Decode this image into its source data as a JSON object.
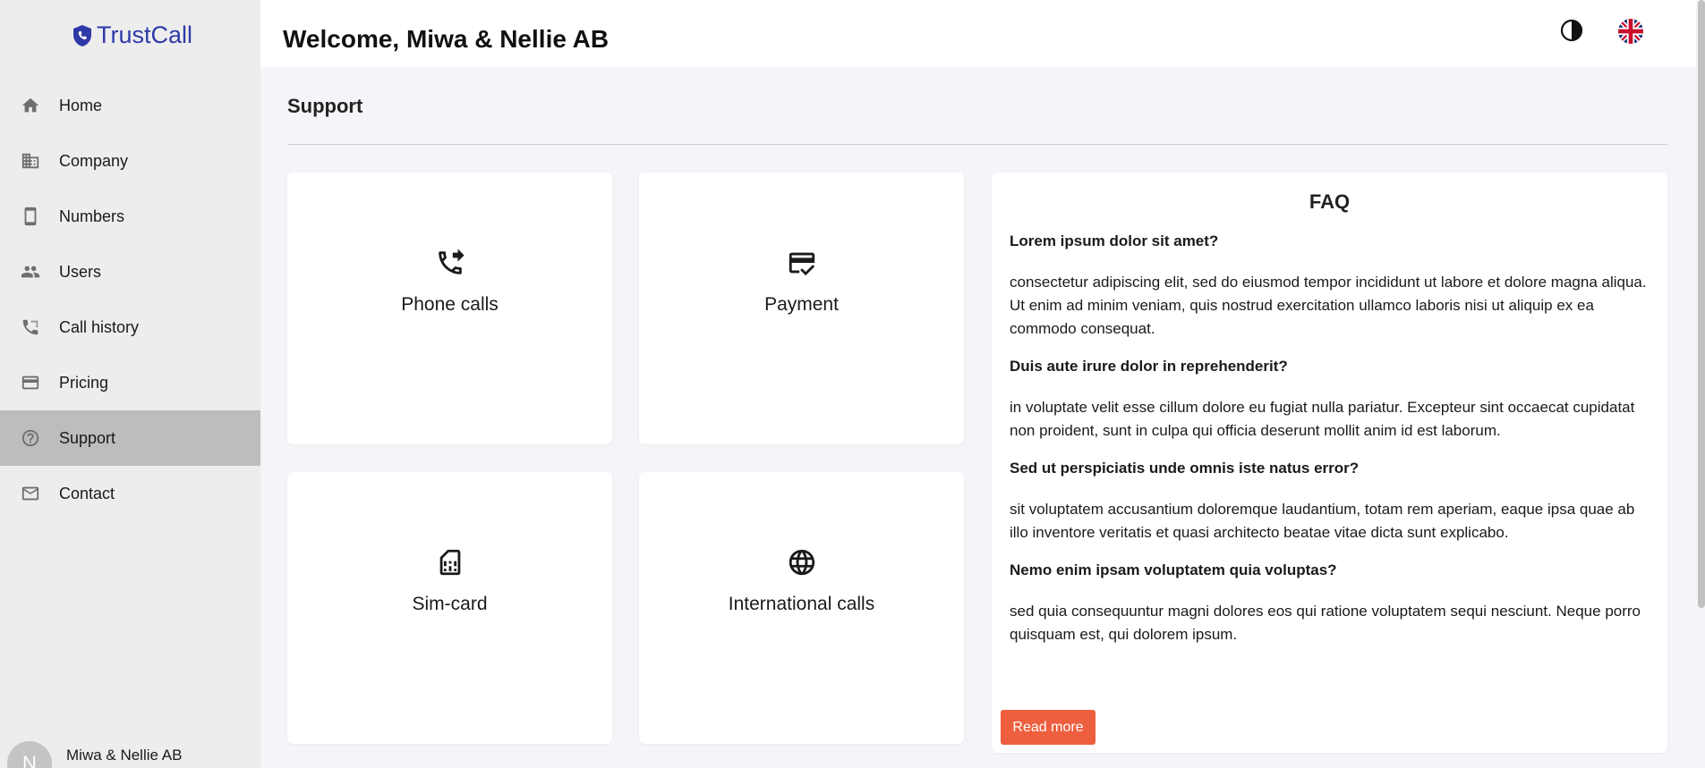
{
  "app": {
    "logo_text": "TrustCall",
    "logo_color": "#2f3aa8"
  },
  "sidebar": {
    "items": [
      {
        "label": "Home",
        "icon": "home-icon"
      },
      {
        "label": "Company",
        "icon": "building-icon"
      },
      {
        "label": "Numbers",
        "icon": "smartphone-icon"
      },
      {
        "label": "Users",
        "icon": "users-icon"
      },
      {
        "label": "Call history",
        "icon": "call-history-icon"
      },
      {
        "label": "Pricing",
        "icon": "credit-card-icon"
      },
      {
        "label": "Support",
        "icon": "help-circle-icon",
        "active": true
      },
      {
        "label": "Contact",
        "icon": "mail-icon"
      }
    ],
    "user": {
      "avatar_initial": "N",
      "name": "Miwa & Nellie AB"
    }
  },
  "header": {
    "title": "Welcome, Miwa & Nellie AB",
    "theme_icon": "contrast-icon",
    "language_icon": "uk-flag-icon"
  },
  "main": {
    "section_title": "Support",
    "cards": [
      {
        "label": "Phone calls",
        "icon": "phone-forwarded-icon"
      },
      {
        "label": "Payment",
        "icon": "payment-card-check-icon"
      },
      {
        "label": "Sim-card",
        "icon": "sim-card-icon"
      },
      {
        "label": "International calls",
        "icon": "globe-icon"
      }
    ],
    "faq": {
      "title": "FAQ",
      "items": [
        {
          "q": "Lorem ipsum dolor sit amet?",
          "a": "consectetur adipiscing elit, sed do eiusmod tempor incididunt ut labore et dolore magna aliqua. Ut enim ad minim veniam, quis nostrud exercitation ullamco laboris nisi ut aliquip ex ea commodo consequat."
        },
        {
          "q": "Duis aute irure dolor in reprehenderit?",
          "a": "in voluptate velit esse cillum dolore eu fugiat nulla pariatur. Excepteur sint occaecat cupidatat non proident, sunt in culpa qui officia deserunt mollit anim id est laborum."
        },
        {
          "q": "Sed ut perspiciatis unde omnis iste natus error?",
          "a": "sit voluptatem accusantium doloremque laudantium, totam rem aperiam, eaque ipsa quae ab illo inventore veritatis et quasi architecto beatae vitae dicta sunt explicabo."
        },
        {
          "q": "Nemo enim ipsam voluptatem quia voluptas?",
          "a": "sed quia consequuntur magni dolores eos qui ratione voluptatem sequi nesciunt. Neque porro quisquam est, qui dolorem ipsum."
        }
      ],
      "read_more_label": "Read more",
      "read_more_color": "#ee5f3f"
    }
  }
}
